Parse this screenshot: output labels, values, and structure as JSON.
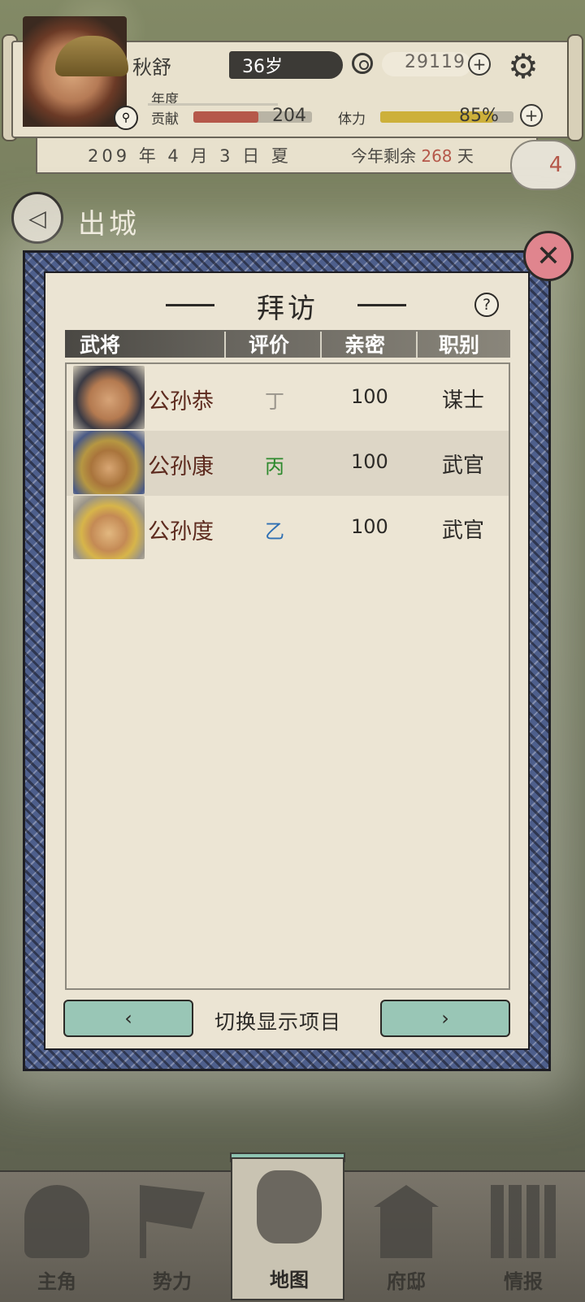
{
  "player": {
    "name": "秋舒",
    "age": "36岁",
    "money": "29119",
    "year_label": "年度",
    "contribution_label": "贡献",
    "contribution_value": "204",
    "contribution_fraction": 0.55,
    "energy_label": "体力",
    "energy_value": "85%",
    "energy_fraction": 0.85
  },
  "date": {
    "text": "209 年 4 月 3 日 夏",
    "remain_prefix": "今年剩余 ",
    "remain_days": "268",
    "remain_suffix": " 天",
    "badge": "4"
  },
  "back": {
    "label": "出城"
  },
  "dialog": {
    "title": "拜访",
    "columns": [
      "武将",
      "评价",
      "亲密",
      "职别"
    ],
    "rows": [
      {
        "name": "公孙恭",
        "grade": "丁",
        "grade_color": "#9a958c",
        "closeness": "100",
        "role": "谋士"
      },
      {
        "name": "公孙康",
        "grade": "丙",
        "grade_color": "#2e8a2e",
        "closeness": "100",
        "role": "武官"
      },
      {
        "name": "公孙度",
        "grade": "乙",
        "grade_color": "#2e6fb3",
        "closeness": "100",
        "role": "武官"
      }
    ],
    "footer_label": "切换显示项目",
    "prev": "‹",
    "next": "›"
  },
  "nav": [
    "主角",
    "势力",
    "地图",
    "府邸",
    "情报"
  ],
  "colors": {
    "accent_red": "#b5584a",
    "teal_button": "#99c6b6",
    "close_pink": "#e0858e"
  }
}
